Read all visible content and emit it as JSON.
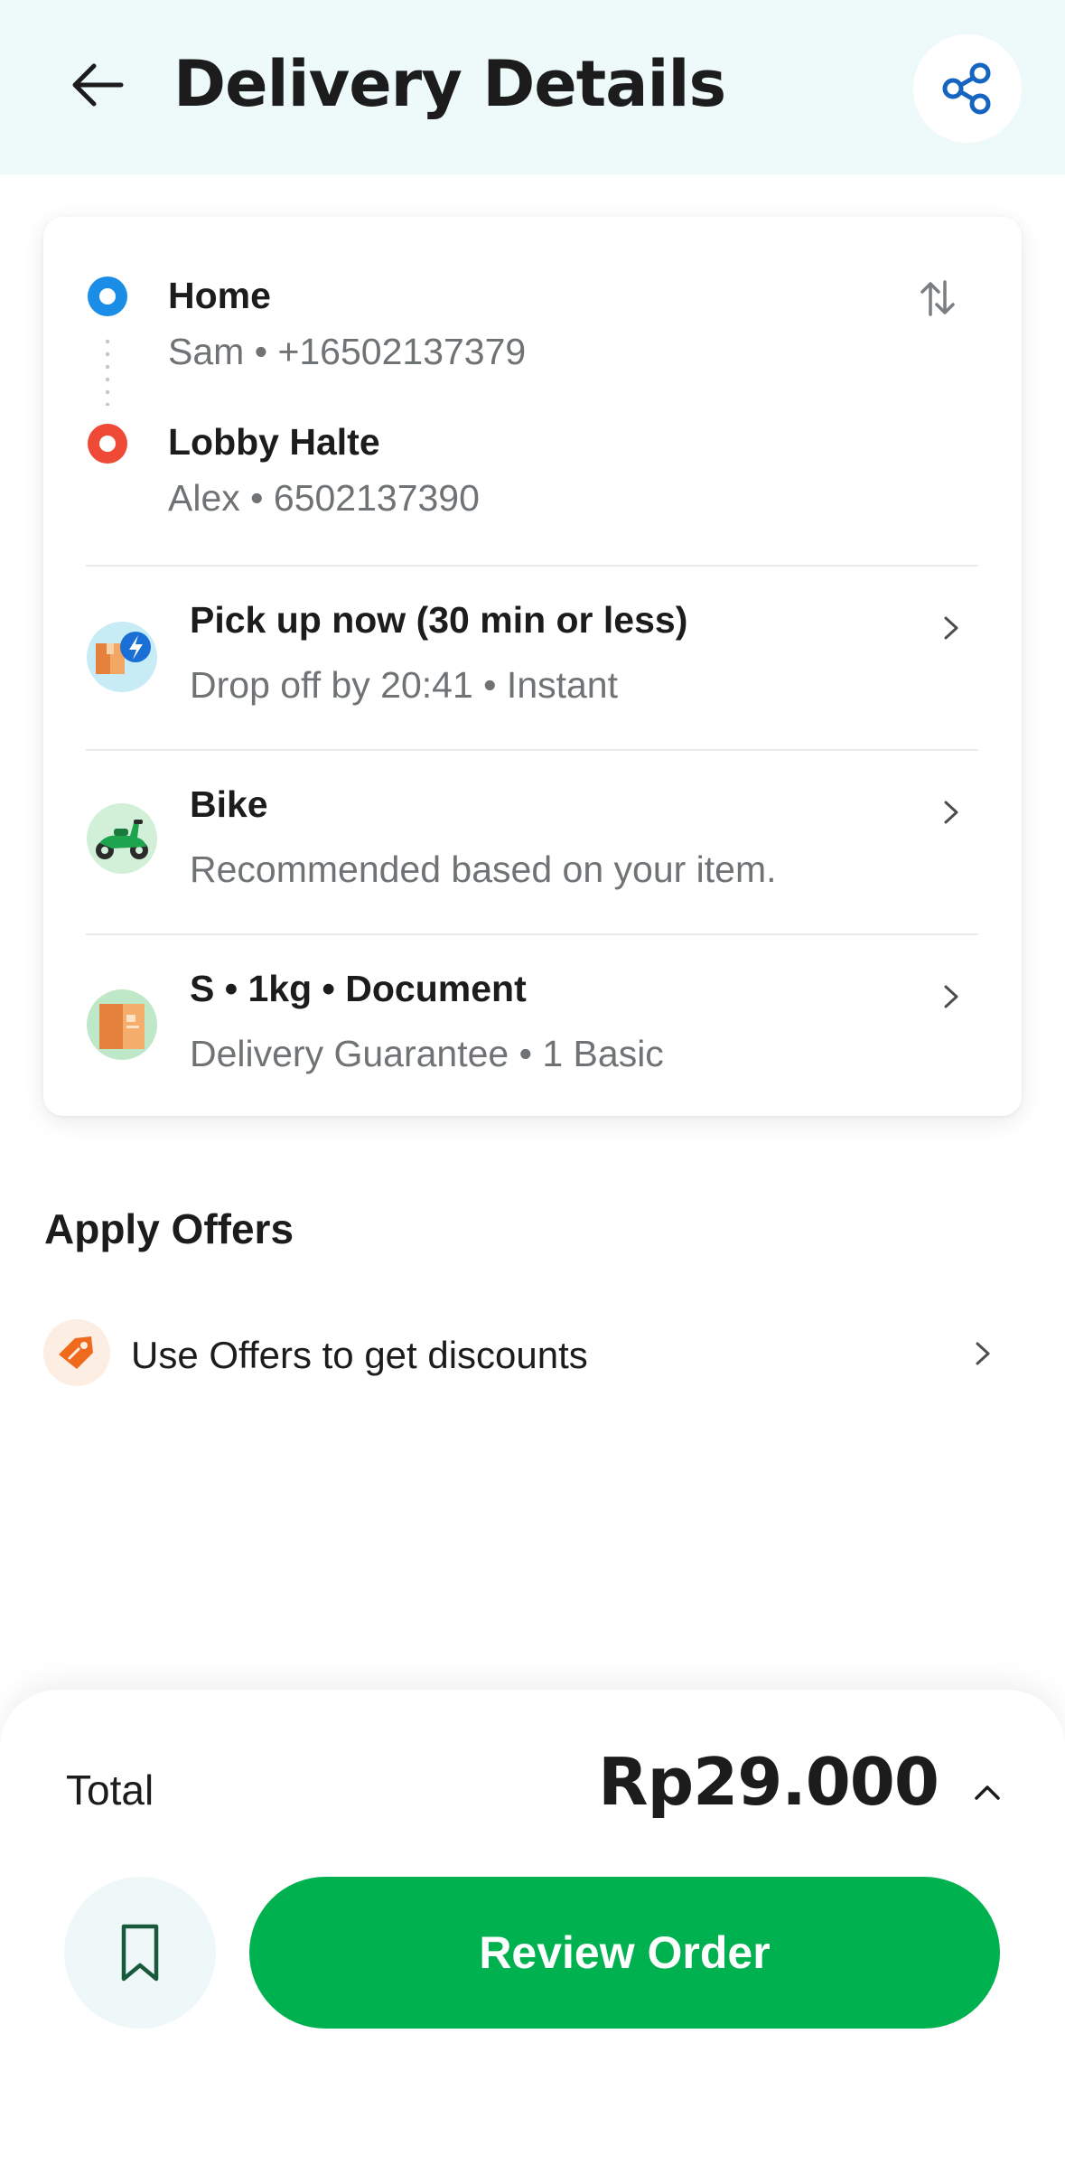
{
  "header": {
    "title": "Delivery Details",
    "back_icon": "arrow-left-icon",
    "share_icon": "share-icon"
  },
  "route": {
    "pickup": {
      "name": "Home",
      "contact": "Sam • +16502137379"
    },
    "dropoff": {
      "name": "Lobby Halte",
      "contact": "Alex • 6502137390"
    },
    "swap_icon": "swap-vertical-icon"
  },
  "options": [
    {
      "title": "Pick up now (30 min or less)",
      "subtitle": "Drop off by 20:41 • Instant",
      "icon": "instant-package-icon"
    },
    {
      "title": "Bike",
      "subtitle": "Recommended based on your item.",
      "icon": "motorbike-icon"
    },
    {
      "title": "S • 1kg • Document",
      "subtitle": "Delivery Guarantee • 1 Basic",
      "icon": "package-box-icon"
    }
  ],
  "offers": {
    "title": "Apply Offers",
    "row_text": "Use Offers to get discounts",
    "icon": "tag-icon"
  },
  "footer": {
    "total_label": "Total",
    "total_amount": "Rp29.000",
    "review_button": "Review Order",
    "bookmark_icon": "bookmark-icon"
  },
  "colors": {
    "header_bg": "#eefafa",
    "primary_green": "#00b14f",
    "pickup_blue": "#1a8de6",
    "dropoff_red": "#ee4a35",
    "secondary_text": "#6f7375",
    "share_blue": "#1565c0"
  }
}
